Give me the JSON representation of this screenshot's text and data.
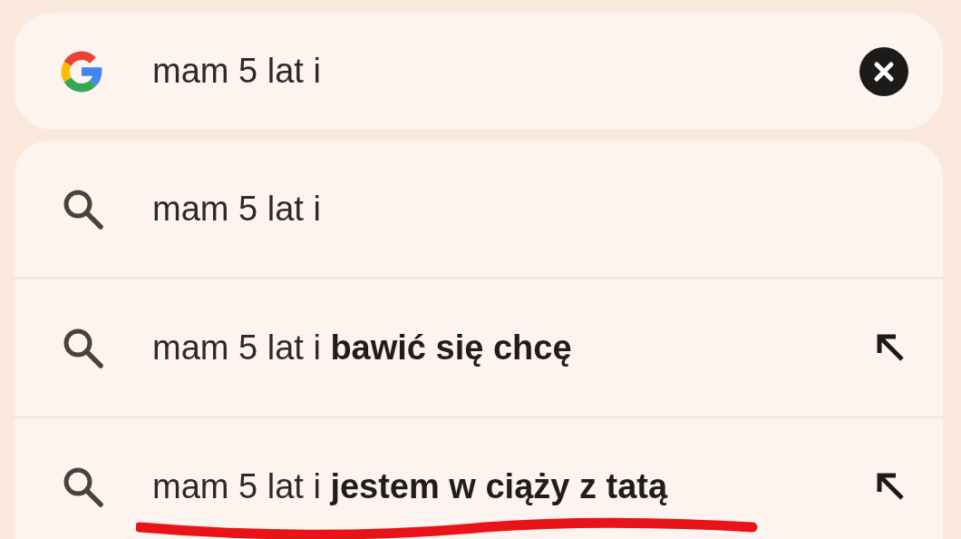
{
  "search": {
    "value": "mam 5 lat i"
  },
  "suggestions": [
    {
      "text": "mam 5 lat i",
      "kind": "query"
    },
    {
      "text": "mam 5 lat i **bawić się chcę**",
      "kind": "completion"
    },
    {
      "text": "mam 5 lat i **jestem w ciąży z tatą**",
      "kind": "completion"
    }
  ]
}
